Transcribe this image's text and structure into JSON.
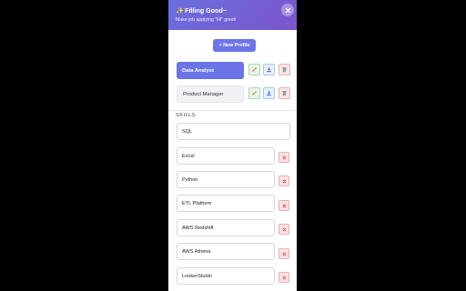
{
  "header": {
    "sparkle": "✨",
    "title": "Filling Good~",
    "subtitle": "Make job applying \"fill\" good!",
    "close_icon": "close-icon"
  },
  "new_profile_label": "+ New Profile",
  "profiles": [
    {
      "label": "Data Analyst",
      "active": true
    },
    {
      "label": "Product Manager",
      "active": false
    }
  ],
  "profile_actions": [
    "pencil-icon",
    "download-icon",
    "trash-icon"
  ],
  "skills_label": "SKILLS",
  "skills": [
    {
      "value": "SQL"
    },
    {
      "value": "Excel"
    },
    {
      "value": "Python"
    },
    {
      "value": "ETL Platform"
    },
    {
      "value": "AWS Redshift"
    },
    {
      "value": "AWS Athena"
    },
    {
      "value": "LookerStudio"
    }
  ],
  "colors": {
    "header_gradient_start": "#6a6fe0",
    "header_gradient_end": "#7b55c9",
    "accent": "#6b74e6",
    "delete_red": "#e05555"
  }
}
